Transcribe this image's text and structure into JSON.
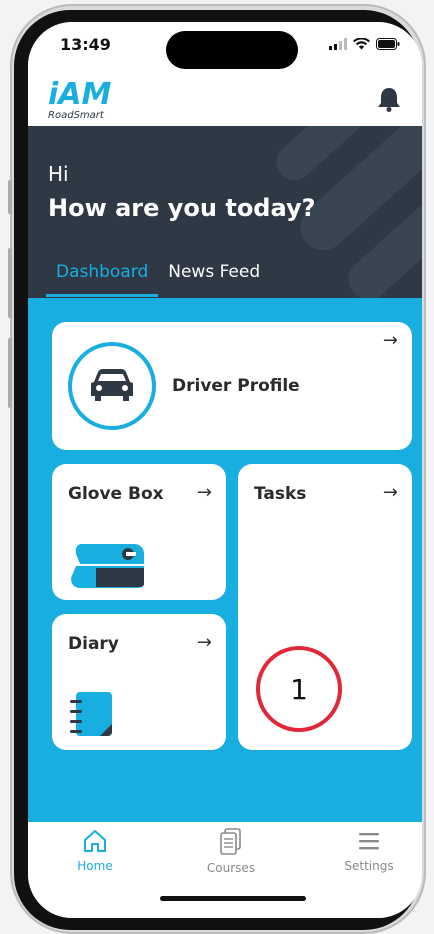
{
  "status": {
    "time": "13:49"
  },
  "brand": {
    "logo_text": "iAM",
    "logo_sub": "RoadSmart"
  },
  "hero": {
    "greeting": "Hi",
    "question": "How are you today?"
  },
  "tabs": [
    {
      "label": "Dashboard",
      "active": true
    },
    {
      "label": "News Feed",
      "active": false
    }
  ],
  "cards": {
    "driver_profile": {
      "title": "Driver Profile",
      "arrow": "→"
    },
    "glove_box": {
      "title": "Glove Box",
      "arrow": "→"
    },
    "tasks": {
      "title": "Tasks",
      "arrow": "→",
      "count": "1"
    },
    "diary": {
      "title": "Diary",
      "arrow": "→"
    }
  },
  "nav": [
    {
      "label": "Home",
      "icon": "home-icon",
      "active": true
    },
    {
      "label": "Courses",
      "icon": "courses-icon",
      "active": false
    },
    {
      "label": "Settings",
      "icon": "menu-icon",
      "active": false
    }
  ],
  "colors": {
    "accent": "#19aee0",
    "dark": "#2e3945",
    "alert": "#e0283a"
  }
}
